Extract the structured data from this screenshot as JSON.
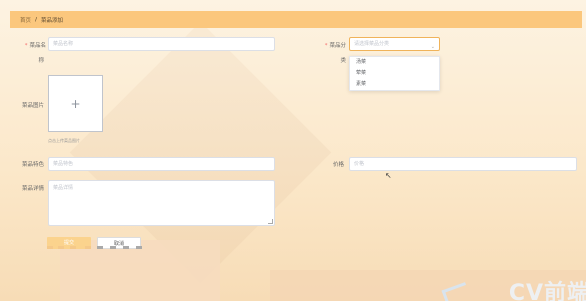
{
  "breadcrumb": {
    "home": "首页",
    "separator": "/",
    "current": "菜品添加"
  },
  "form": {
    "name_label_line1": "菜品名",
    "name_label_line2": "称",
    "name_placeholder": "菜品名称",
    "category_label_line1": "菜品分",
    "category_label_line2": "类",
    "category_placeholder": "请选择菜品分类",
    "category_options": [
      "汤菜",
      "荤菜",
      "素菜"
    ],
    "image_label": "菜品图片",
    "upload_plus": "+",
    "upload_tip": "点击上传菜品图片",
    "feature_label": "菜品特色",
    "feature_placeholder": "菜品特色",
    "price_label": "价格",
    "price_placeholder": "价格",
    "detail_label": "菜品详情",
    "detail_placeholder": "菜品详情"
  },
  "buttons": {
    "submit": "提交",
    "cancel": "取消"
  },
  "icons": {
    "dropdown_arrow": "chevron-down-icon",
    "upload": "plus-icon"
  },
  "watermark": "CV前端",
  "colors": {
    "breadcrumb_bar": "#fbc77d",
    "primary": "#fbd38d",
    "required": "#f56c6c"
  }
}
